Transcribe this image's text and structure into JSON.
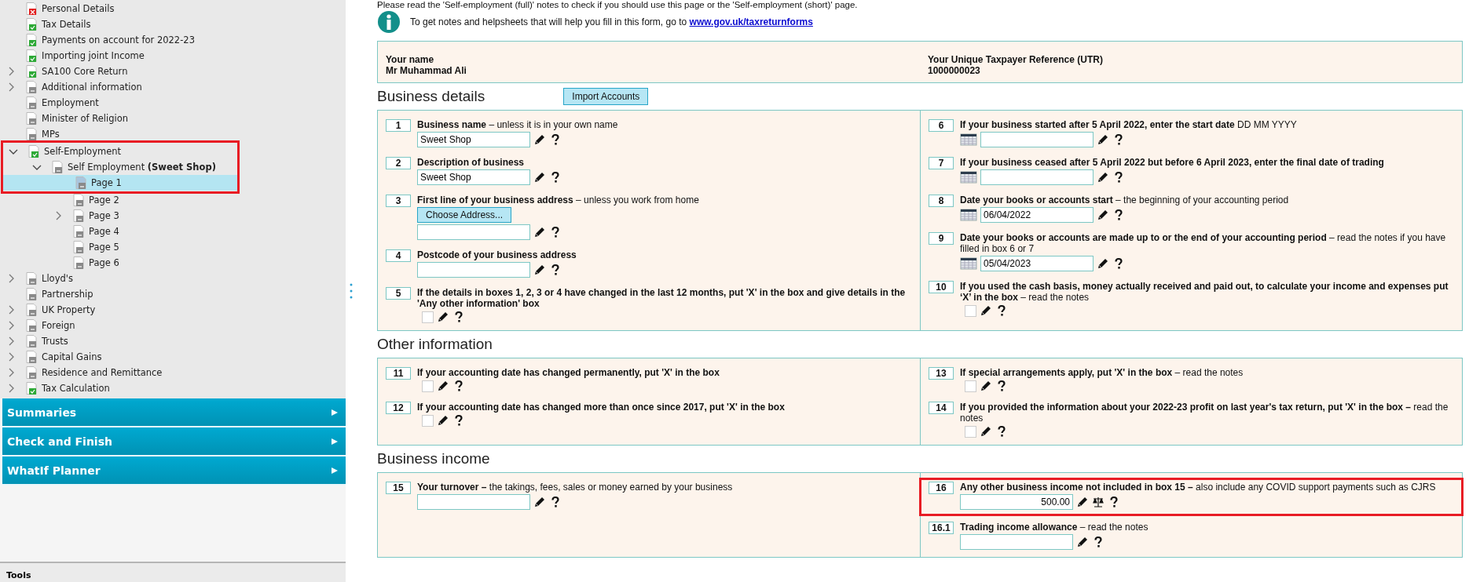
{
  "sidebar": {
    "tree": [
      {
        "label": "Personal Details",
        "kind": "error",
        "selected": false,
        "highlighted": false
      },
      {
        "label": "Tax Details",
        "kind": "complete",
        "selected": false,
        "highlighted": false
      },
      {
        "label": "Payments on account for 2022-23",
        "kind": "complete",
        "selected": false,
        "highlighted": false
      },
      {
        "label": "Importing joint Income",
        "kind": "complete",
        "selected": false,
        "highlighted": false
      },
      {
        "label": "SA100 Core Return",
        "kind": "complete",
        "expanded": false,
        "selected": false,
        "highlighted": false
      },
      {
        "label": "Additional information",
        "kind": "empty",
        "expanded": false,
        "selected": false,
        "highlighted": false
      },
      {
        "label": "Employment",
        "kind": "empty",
        "selected": false,
        "highlighted": false
      },
      {
        "label": "Minister of Religion",
        "kind": "empty",
        "selected": false,
        "highlighted": false
      },
      {
        "label": "MPs",
        "kind": "empty",
        "selected": false,
        "highlighted": false
      },
      {
        "label": "Self-Employment",
        "kind": "complete",
        "expanded": true,
        "selected": false,
        "highlighted": true,
        "children": [
          {
            "label": "Self Employment **(Sweet Shop)**",
            "kind": "empty",
            "expanded": true,
            "selected": false,
            "highlighted": true,
            "children": [
              {
                "label": "Page 1",
                "kind": "empty",
                "selected": true,
                "highlighted": true
              },
              {
                "label": "Page 2",
                "kind": "empty",
                "selected": false,
                "highlighted": false
              },
              {
                "label": "Page 3",
                "kind": "empty",
                "expanded": false,
                "selected": false,
                "highlighted": false
              },
              {
                "label": "Page 4",
                "kind": "empty",
                "selected": false,
                "highlighted": false
              },
              {
                "label": "Page 5",
                "kind": "empty",
                "selected": false,
                "highlighted": false
              },
              {
                "label": "Page 6",
                "kind": "empty",
                "selected": false,
                "highlighted": false
              }
            ]
          }
        ]
      },
      {
        "label": "Lloyd's",
        "kind": "empty",
        "expanded": false,
        "selected": false,
        "highlighted": false
      },
      {
        "label": "Partnership",
        "kind": "empty",
        "selected": false,
        "highlighted": false
      },
      {
        "label": "UK Property",
        "kind": "empty",
        "expanded": false,
        "selected": false,
        "highlighted": false
      },
      {
        "label": "Foreign",
        "kind": "empty",
        "expanded": false,
        "selected": false,
        "highlighted": false
      },
      {
        "label": "Trusts",
        "kind": "empty",
        "expanded": false,
        "selected": false,
        "highlighted": false
      },
      {
        "label": "Capital Gains",
        "kind": "empty",
        "expanded": false,
        "selected": false,
        "highlighted": false
      },
      {
        "label": "Residence and Remittance",
        "kind": "empty",
        "expanded": false,
        "selected": false,
        "highlighted": false
      },
      {
        "label": "Tax Calculation",
        "kind": "complete",
        "expanded": false,
        "selected": false,
        "highlighted": false
      }
    ],
    "panels": [
      "Summaries",
      "Check and Finish",
      "WhatIf Planner"
    ],
    "tools_label": "Tools"
  },
  "form": {
    "intro": "Please read the 'Self-employment (full)' notes to check if you should use this page or the 'Self-employment (short)' page.",
    "notes_text": "To get notes and helpsheets that will help you fill in this form, go to",
    "notes_link": "www.gov.uk/taxreturnforms",
    "taxpayer": [
      {
        "label": "Your name",
        "value": "Mr Muhammad Ali"
      },
      {
        "label": "Your Unique Taxpayer Reference (UTR)",
        "value": "1000000023"
      }
    ],
    "sections": [
      {
        "title": "Business details",
        "button": "Import Accounts",
        "left": [
          {
            "number": "1",
            "label": "Business name",
            "note": "– unless it is in your own name",
            "kind": "text",
            "value": "Sweet Shop",
            "highlighted": false
          },
          {
            "number": "2",
            "label": "Description of business",
            "kind": "text",
            "value": "Sweet Shop",
            "highlighted": false
          },
          {
            "number": "3",
            "label": "First line of your business address",
            "note": "– unless you work from home",
            "kind": "address",
            "button": "Choose Address...",
            "highlighted": false
          },
          {
            "number": "4",
            "label": "Postcode of your business address",
            "kind": "text",
            "highlighted": false
          },
          {
            "number": "5",
            "label": "If the details in boxes 1, 2, 3 or 4 have changed in the last 12 months, put 'X' in the box and give details in the 'Any other information' box",
            "kind": "checkbox",
            "checked": false,
            "highlighted": false
          }
        ],
        "right": [
          {
            "number": "6",
            "label": "If your business started after 5 April 2022, enter the start date",
            "note": "DD MM YYYY",
            "kind": "date",
            "highlighted": false
          },
          {
            "number": "7",
            "label": "If your business ceased after 5 April 2022 but before 6 April 2023, enter the final date of trading",
            "kind": "date",
            "highlighted": false
          },
          {
            "number": "8",
            "label": "Date your books or accounts start",
            "note": "– the beginning of your accounting period",
            "kind": "date",
            "value": "06/04/2022",
            "highlighted": false
          },
          {
            "number": "9",
            "label": "Date your books or accounts are made up to or the end of your accounting period",
            "note": "– read the notes if you have filled in box 6 or 7",
            "kind": "date",
            "value": "05/04/2023",
            "highlighted": false
          },
          {
            "number": "10",
            "label": "If you used the cash basis, money actually received and paid out, to calculate your income and expenses put ‘X’ in the box",
            "note": "– read the notes",
            "kind": "checkbox",
            "checked": false,
            "highlighted": false
          }
        ]
      },
      {
        "title": "Other information",
        "left": [
          {
            "number": "11",
            "label": "If your accounting date has changed permanently, put 'X' in the box",
            "kind": "checkbox",
            "checked": false,
            "highlighted": false
          },
          {
            "number": "12",
            "label": "If your accounting date has changed more than once since 2017, put 'X' in the box",
            "kind": "checkbox",
            "checked": false,
            "highlighted": false
          }
        ],
        "right": [
          {
            "number": "13",
            "label": "If special arrangements apply, put 'X' in the box",
            "note": "– read the notes",
            "kind": "checkbox",
            "checked": false,
            "highlighted": false
          },
          {
            "number": "14",
            "label": "If you provided the information about your 2022-23 profit on last year's tax return, put 'X' in the box –",
            "note": "read the notes",
            "kind": "checkbox",
            "checked": false,
            "highlighted": false
          }
        ]
      },
      {
        "title": "Business income",
        "left": [
          {
            "number": "15",
            "label": "Your turnover –",
            "note": "the takings, fees, sales or money earned by your business",
            "kind": "amount",
            "breakdown": false,
            "highlighted": false
          }
        ],
        "right": [
          {
            "number": "16",
            "label": "Any other business income not included in box 15 –",
            "note": "also include any COVID support payments such as CJRS",
            "kind": "amount",
            "value": "500.00",
            "breakdown": true,
            "highlighted": true
          },
          {
            "number": "16.1",
            "label": "Trading income allowance",
            "note": "– read the notes",
            "kind": "amount",
            "breakdown": false,
            "highlighted": false
          }
        ]
      }
    ]
  }
}
